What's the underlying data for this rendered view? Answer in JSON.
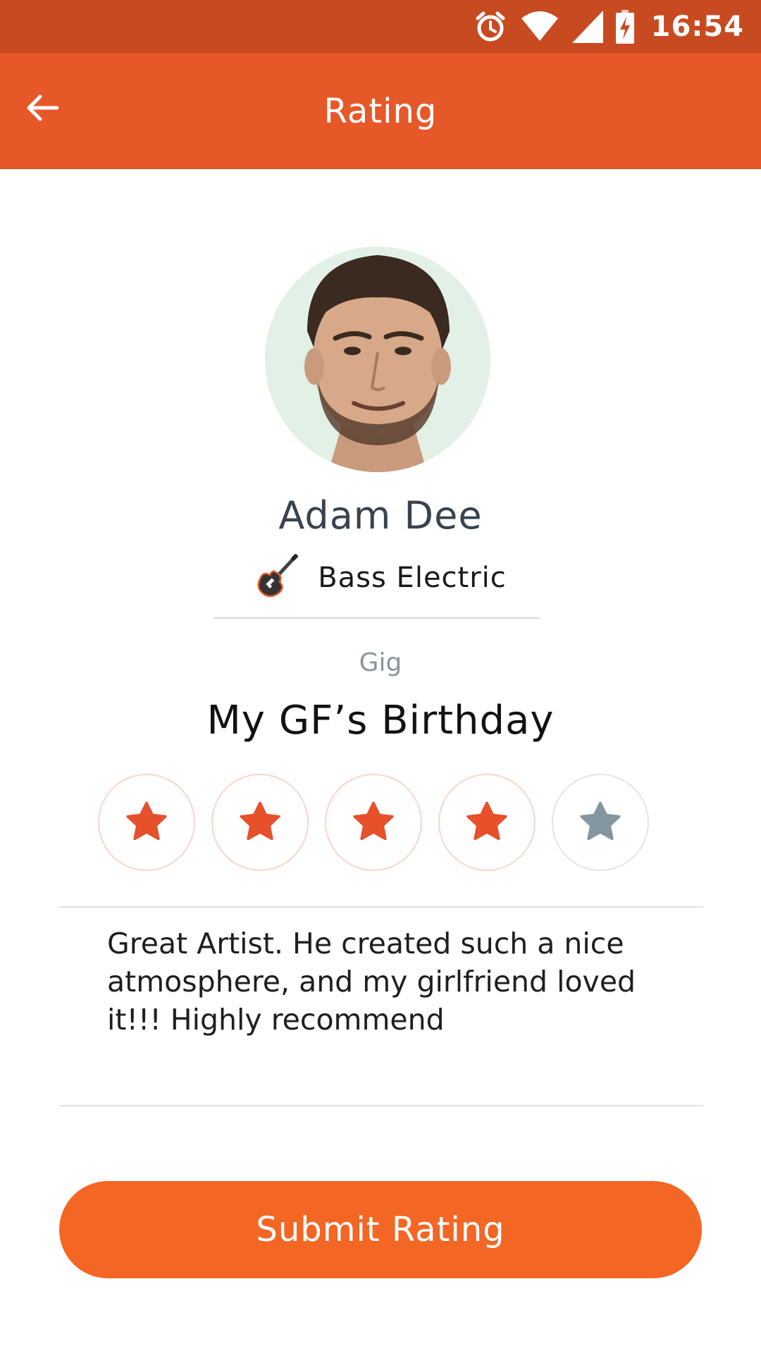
{
  "status_bar": {
    "time": "16:54",
    "icons": [
      "alarm-icon",
      "wifi-icon",
      "signal-icon",
      "battery-charging-icon"
    ]
  },
  "app_bar": {
    "title": "Rating",
    "back_icon": "arrow-left-icon"
  },
  "artist": {
    "name": "Adam Dee",
    "instrument": "Bass Electric",
    "instrument_icon": "bass-guitar-icon"
  },
  "gig": {
    "label": "Gig",
    "title": "My GF’s Birthday"
  },
  "rating": {
    "value": 4,
    "max": 5,
    "active_color": "#e6502a",
    "inactive_color": "#8496a0"
  },
  "review": {
    "text": "Great Artist. He created such a nice atmosphere, and my girlfriend loved it!!! Highly recommend"
  },
  "submit": {
    "label": "Submit Rating",
    "color": "#f46624"
  },
  "colors": {
    "status_bar": "#c84a21",
    "app_bar": "#e65827"
  }
}
